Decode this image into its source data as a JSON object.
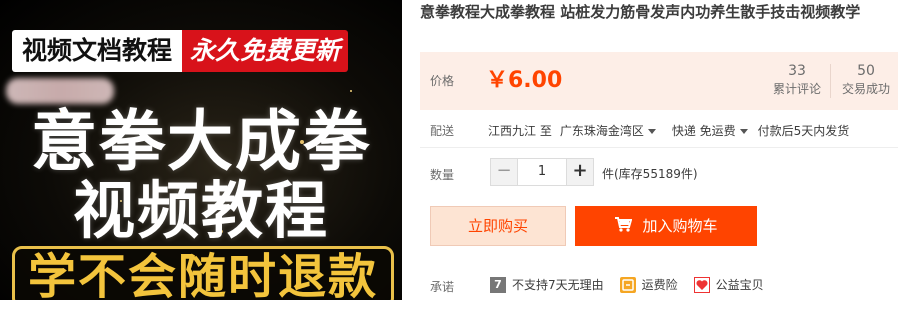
{
  "image": {
    "tag_left": "视频文档教程",
    "tag_right": "永久免费更新",
    "title_line1": "意拳大成拳",
    "title_line2": "视频教程",
    "bottom_banner": "学不会随时退款"
  },
  "product": {
    "title": "意拳教程大成拳教程 站桩发力筋骨发声内功养生散手技击视频教学"
  },
  "price": {
    "label": "价格",
    "value": "￥6.00",
    "reviews_count": "33",
    "reviews_label": "累计评论",
    "sold_count": "50",
    "sold_label": "交易成功"
  },
  "shipping": {
    "label": "配送",
    "from": "江西九江 至",
    "to": "广东珠海金湾区",
    "method": "快递 免运费",
    "delivery": "付款后5天内发货"
  },
  "quantity": {
    "label": "数量",
    "minus": "−",
    "value": "1",
    "plus": "+",
    "stock": "件(库存55189件)"
  },
  "actions": {
    "buy_now": "立即购买",
    "add_to_cart": "加入购物车"
  },
  "promise": {
    "label": "承诺",
    "items": [
      {
        "icon": "seven-day-icon",
        "text": "不支持7天无理由"
      },
      {
        "icon": "shipping-insurance-icon",
        "text": "运费险"
      },
      {
        "icon": "charity-icon",
        "text": "公益宝贝"
      }
    ]
  },
  "colors": {
    "accent": "#ff4400",
    "price_bg": "#fdeee7",
    "buy_bg": "#fde4d3"
  }
}
